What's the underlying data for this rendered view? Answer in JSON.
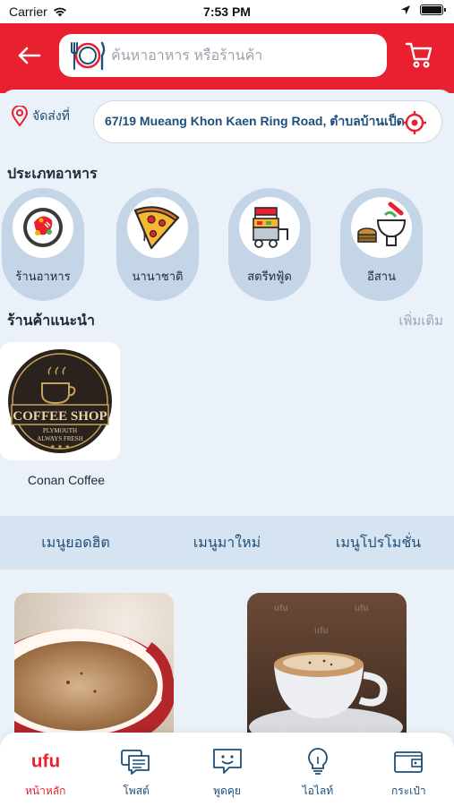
{
  "status_bar": {
    "carrier": "Carrier",
    "time": "7:53 PM"
  },
  "header": {
    "search_placeholder": "ค้นหาอาหาร หรือร้านค้า",
    "brand_color": "#e8202f"
  },
  "delivery": {
    "label": "จัดส่งที่",
    "address": "67/19 Mueang Khon Kaen Ring Road, ตำบลบ้านเป็ด"
  },
  "categories": {
    "title": "ประเภทอาหาร",
    "items": [
      {
        "label": "ร้านอาหาร",
        "icon": "thai-dish-icon"
      },
      {
        "label": "นานาชาติ",
        "icon": "pizza-icon"
      },
      {
        "label": "สตรีทฟู้ด",
        "icon": "food-cart-icon"
      },
      {
        "label": "อีสาน",
        "icon": "mortar-pestle-icon"
      }
    ]
  },
  "recommended": {
    "title": "ร้านค้าแนะนำ",
    "more": "เพิ่มเติม",
    "shops": [
      {
        "name": "Conan Coffee",
        "logo_lines": [
          "COFFEE SHOP",
          "PLYMOUTH",
          "ALWAYS FRESH"
        ]
      }
    ]
  },
  "menu_tabs": [
    "เมนูยอดฮิต",
    "เมนูมาใหม่",
    "เมนูโปรโมชั่น"
  ],
  "photos": [
    {
      "subject": "coffee-cup-closeup"
    },
    {
      "subject": "cappuccino-cup",
      "watermark": "ufu"
    }
  ],
  "bottom_nav": [
    {
      "label": "หน้าหลัก",
      "icon": "home-logo-icon",
      "active": true
    },
    {
      "label": "โพสต์",
      "icon": "post-icon",
      "active": false
    },
    {
      "label": "พูดคุย",
      "icon": "chat-icon",
      "active": false
    },
    {
      "label": "ไอไลท์",
      "icon": "lightbulb-icon",
      "active": false
    },
    {
      "label": "กระเป๋า",
      "icon": "wallet-icon",
      "active": false
    }
  ],
  "brand_logo": "ufu"
}
